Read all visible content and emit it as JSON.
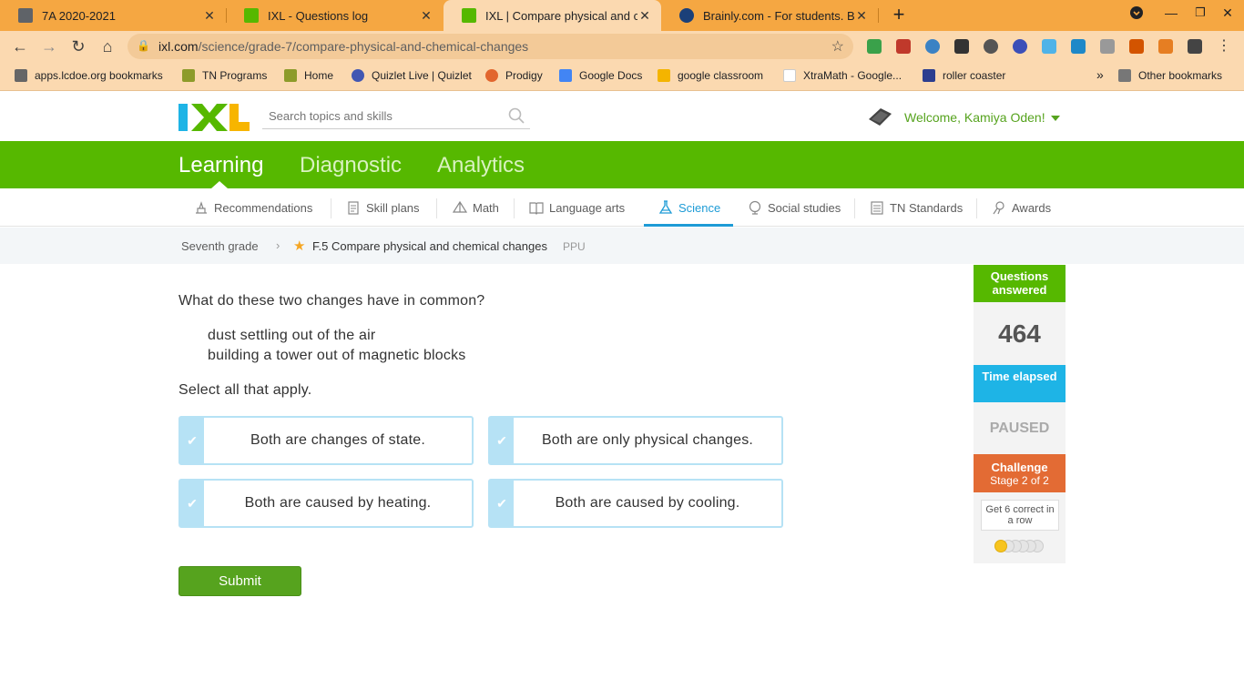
{
  "browser": {
    "tabs": [
      {
        "title": "7A 2020-2021",
        "favicon_color": "#5f6368"
      },
      {
        "title": "IXL - Questions log",
        "favicon_color": "#56b800"
      },
      {
        "title": "IXL | Compare physical and chemical changes",
        "favicon_color": "#56b800"
      },
      {
        "title": "Brainly.com - For students. By students.",
        "favicon_color": "#1b4079"
      }
    ],
    "url_host": "ixl.com",
    "url_path": "/science/grade-7/compare-physical-and-chemical-changes",
    "bookmarks": [
      "apps.lcdoe.org bookmarks",
      "TN Programs",
      "Home",
      "Quizlet Live | Quizlet",
      "Prodigy",
      "Google Docs",
      "google classroom",
      "XtraMath - Google...",
      "roller coaster"
    ],
    "bookmarks_more": "»",
    "other_bookmarks": "Other bookmarks"
  },
  "header": {
    "search_placeholder": "Search topics and skills",
    "welcome": "Welcome, Kamiya Oden!"
  },
  "main_nav": {
    "items": [
      "Learning",
      "Diagnostic",
      "Analytics"
    ],
    "active": "Learning"
  },
  "sub_nav": {
    "items": [
      "Recommendations",
      "Skill plans",
      "Math",
      "Language arts",
      "Science",
      "Social studies",
      "TN Standards",
      "Awards"
    ],
    "active": "Science"
  },
  "breadcrumb": {
    "grade": "Seventh grade",
    "skill": "F.5 Compare physical and chemical changes",
    "code": "PPU"
  },
  "question": {
    "prompt": "What do these two changes have in common?",
    "changes": [
      "dust settling out of the air",
      "building a tower out of magnetic blocks"
    ],
    "instruction": "Select all that apply.",
    "choices": [
      "Both are changes of state.",
      "Both are only physical changes.",
      "Both are caused by heating.",
      "Both are caused by cooling."
    ],
    "submit_label": "Submit"
  },
  "sidebar": {
    "questions_answered_label": "Questions answered",
    "questions_answered": "464",
    "time_elapsed_label": "Time elapsed",
    "time_status": "PAUSED",
    "challenge_label": "Challenge",
    "challenge_stage": "Stage 2 of 2",
    "goal": "Get 6 correct in a row",
    "progress_dots_filled": 1,
    "progress_dots_total": 6
  },
  "colors": {
    "ixl_green": "#56b800",
    "science_blue": "#1d9bd6",
    "challenge_orange": "#e36b34",
    "browser_orange": "#f5a742"
  }
}
